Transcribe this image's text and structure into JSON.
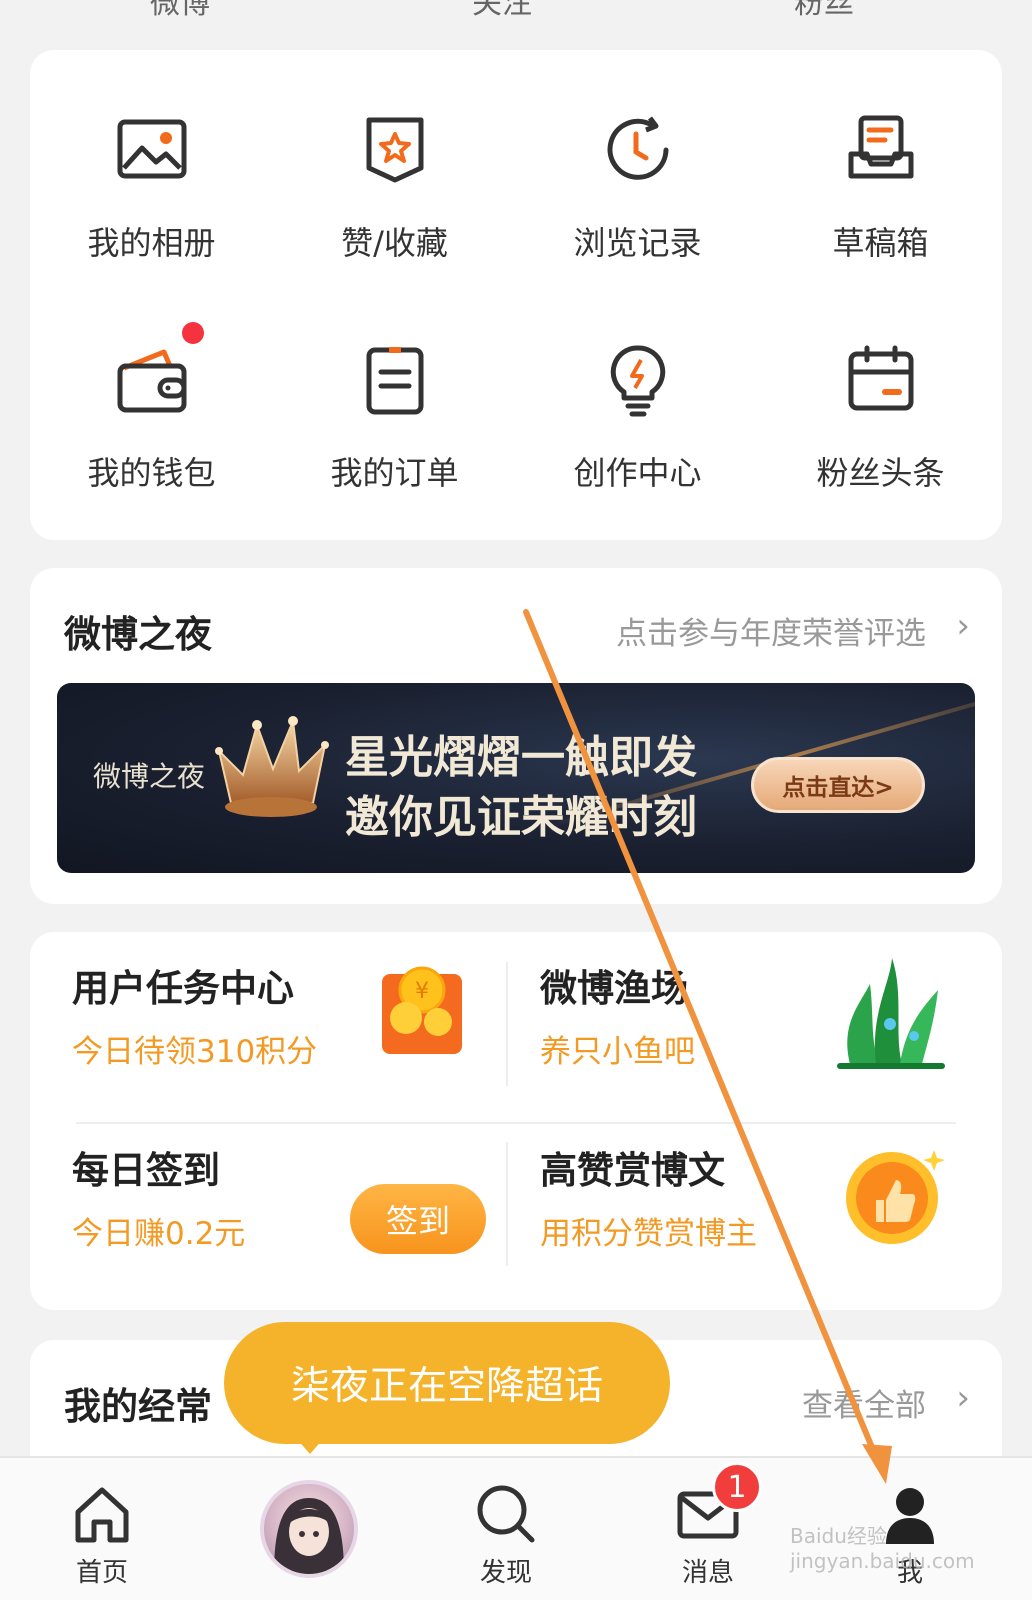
{
  "top_stats": [
    "微博",
    "关注",
    "粉丝"
  ],
  "grid": [
    {
      "label": "我的相册",
      "icon": "photo-album-icon"
    },
    {
      "label": "赞/收藏",
      "icon": "favorite-badge-icon"
    },
    {
      "label": "浏览记录",
      "icon": "history-clock-icon"
    },
    {
      "label": "草稿箱",
      "icon": "drafts-tray-icon"
    },
    {
      "label": "我的钱包",
      "icon": "wallet-icon"
    },
    {
      "label": "我的订单",
      "icon": "orders-list-icon"
    },
    {
      "label": "创作中心",
      "icon": "creator-bulb-icon"
    },
    {
      "label": "粉丝头条",
      "icon": "calendar-icon"
    }
  ],
  "weibo_night": {
    "title": "微博之夜",
    "link": "点击参与年度荣誉评选",
    "banner": {
      "brand": "微博之夜",
      "line1": "星光熠熠一触即发",
      "line2": "邀你见证荣耀时刻",
      "button": "点击直达>"
    }
  },
  "tasks": [
    {
      "title": "用户任务中心",
      "subtitle": "今日待领310积分"
    },
    {
      "title": "微博渔场",
      "subtitle": "养只小鱼吧"
    },
    {
      "title": "每日签到",
      "subtitle": "今日赚0.2元",
      "button": "签到"
    },
    {
      "title": "高赞赏博文",
      "subtitle": "用积分赞赏博主"
    }
  ],
  "frequent": {
    "title": "我的经常",
    "link": "查看全部"
  },
  "bubble": "柒夜正在空降超话",
  "tabbar": {
    "home": "首页",
    "discover": "发现",
    "messages": "消息",
    "messages_badge": "1",
    "me": "我"
  },
  "watermark": "Baidu经验 jingyan.baidu.com",
  "colors": {
    "accent": "#f39a25",
    "icon": "#333333",
    "icon_accent": "#f26b1d",
    "annotation": "#f0923e"
  }
}
